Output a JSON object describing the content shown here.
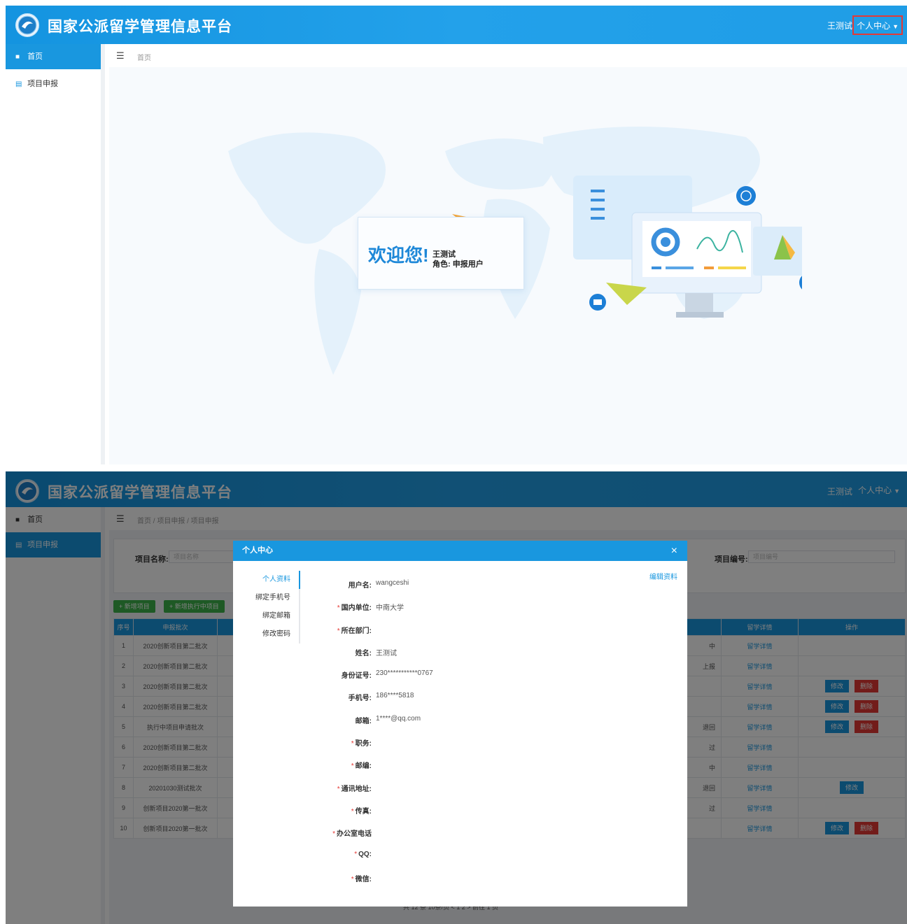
{
  "app": {
    "title": "国家公派留学管理信息平台",
    "user_name": "王测试",
    "user_center": "个人中心",
    "caret": "▼"
  },
  "sidebar": {
    "items": [
      {
        "icon": "home-icon",
        "label": "首页"
      },
      {
        "icon": "list-icon",
        "label": "项目申报"
      }
    ]
  },
  "screen1": {
    "breadcrumb": "首页",
    "welcome": "欢迎您!",
    "welcome_name": "王测试",
    "welcome_role": "角色: 申报用户"
  },
  "screen2": {
    "breadcrumb": "首页 / 项目申报 / 项目申报",
    "search": {
      "name_label": "项目名称:",
      "name_placeholder": "项目名称",
      "code_label": "项目编号:",
      "code_placeholder": "项目编号"
    },
    "buttons": {
      "add": "+ 新增项目",
      "add_exec": "+ 新增执行中项目"
    },
    "table": {
      "headers": [
        "序号",
        "申报批次",
        "",
        "留学详情",
        "操作"
      ],
      "rows": [
        {
          "no": "1",
          "batch": "2020创新项目第二批次",
          "status": "中",
          "detail": "留学详情",
          "edit": "",
          "del": ""
        },
        {
          "no": "2",
          "batch": "2020创新项目第二批次",
          "status": "上报",
          "detail": "留学详情",
          "edit": "",
          "del": ""
        },
        {
          "no": "3",
          "batch": "2020创新项目第二批次",
          "status": "",
          "detail": "留学详情",
          "edit": "修改",
          "del": "删除"
        },
        {
          "no": "4",
          "batch": "2020创新项目第二批次",
          "status": "",
          "detail": "留学详情",
          "edit": "修改",
          "del": "删除"
        },
        {
          "no": "5",
          "batch": "执行中项目申请批次",
          "status": "退回",
          "detail": "留学详情",
          "edit": "修改",
          "del": "删除"
        },
        {
          "no": "6",
          "batch": "2020创新项目第二批次",
          "status": "过",
          "detail": "留学详情",
          "edit": "",
          "del": ""
        },
        {
          "no": "7",
          "batch": "2020创新项目第二批次",
          "status": "中",
          "detail": "留学详情",
          "edit": "",
          "del": ""
        },
        {
          "no": "8",
          "batch": "20201030测试批次",
          "status": "退回",
          "detail": "留学详情",
          "edit": "修改",
          "del": ""
        },
        {
          "no": "9",
          "batch": "创新项目2020第一批次",
          "status": "过",
          "detail": "留学详情",
          "edit": "",
          "del": ""
        },
        {
          "no": "10",
          "batch": "创新项目2020第一批次",
          "status": "",
          "detail": "留学详情",
          "edit": "修改",
          "del": "删除"
        }
      ]
    },
    "pager": "共 12 条    10条/页        <   1   2   >    前往   1   页"
  },
  "modal": {
    "title": "个人中心",
    "close": "×",
    "edit_link": "编辑资料",
    "tabs": [
      "个人资料",
      "绑定手机号",
      "绑定邮箱",
      "修改密码"
    ],
    "fields": [
      {
        "label": "用户名:",
        "value": "wangceshi",
        "required": false
      },
      {
        "label": "国内单位:",
        "value": "中南大学",
        "required": true
      },
      {
        "label": "所在部门:",
        "value": "",
        "required": true
      },
      {
        "label": "姓名:",
        "value": "王测试",
        "required": false
      },
      {
        "label": "身份证号:",
        "value": "230***********0767",
        "required": false
      },
      {
        "label": "手机号:",
        "value": "186****5818",
        "required": false
      },
      {
        "label": "邮箱:",
        "value": "1****@qq.com",
        "required": false
      },
      {
        "label": "职务:",
        "value": "",
        "required": true
      },
      {
        "label": "邮编:",
        "value": "",
        "required": true
      },
      {
        "label": "通讯地址:",
        "value": "",
        "required": true
      },
      {
        "label": "传真:",
        "value": "",
        "required": true
      },
      {
        "label": "办公室电话",
        "value": "",
        "required": true
      },
      {
        "label": "QQ:",
        "value": "",
        "required": true
      },
      {
        "label": "微信:",
        "value": "",
        "required": true
      }
    ]
  },
  "colors": {
    "primary": "#1997df",
    "danger": "#e53935",
    "success": "#3cb34a"
  }
}
